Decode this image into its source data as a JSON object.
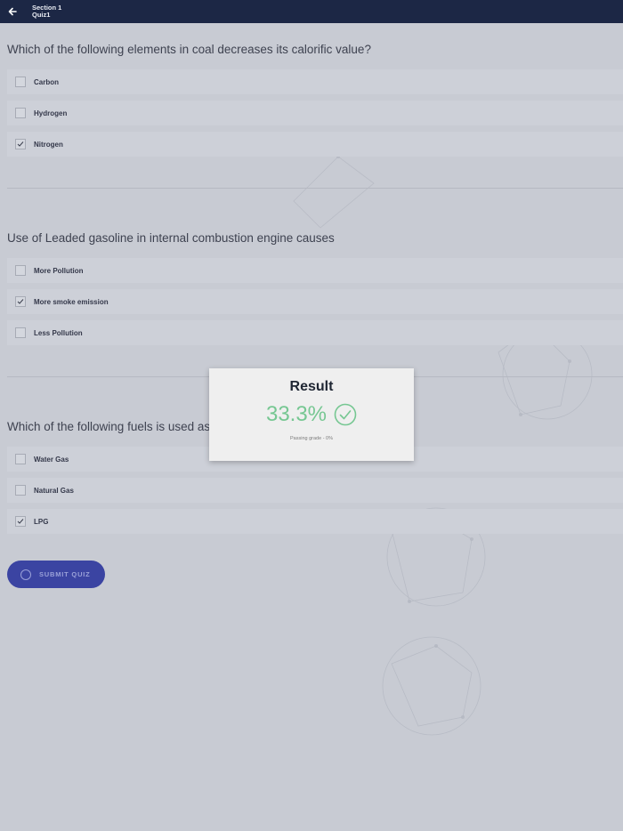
{
  "header": {
    "section": "Section 1",
    "quiz": "Quiz1",
    "back_icon": "arrow-left-icon"
  },
  "questions": [
    {
      "text": "Which of the following elements in coal decreases its calorific value?",
      "options": [
        {
          "label": "Carbon",
          "checked": false
        },
        {
          "label": "Hydrogen",
          "checked": false
        },
        {
          "label": "Nitrogen",
          "checked": true
        }
      ]
    },
    {
      "text": "Use of Leaded gasoline in internal combustion engine causes",
      "options": [
        {
          "label": "More Pollution",
          "checked": false
        },
        {
          "label": "More smoke emission",
          "checked": true
        },
        {
          "label": "Less Pollution",
          "checked": false
        }
      ]
    },
    {
      "text": "Which of the following fuels is used as a s",
      "options": [
        {
          "label": "Water Gas",
          "checked": false
        },
        {
          "label": "Natural Gas",
          "checked": false
        },
        {
          "label": "LPG",
          "checked": true
        }
      ]
    }
  ],
  "submit": {
    "label": "SUBMIT QUIZ"
  },
  "result": {
    "title": "Result",
    "score": "33.3%",
    "passing": "Passing grade - 0%",
    "icon": "check-circle-icon",
    "score_color": "#76c792"
  },
  "colors": {
    "header_bg": "#1c2745",
    "button_bg": "#3b44a2"
  }
}
